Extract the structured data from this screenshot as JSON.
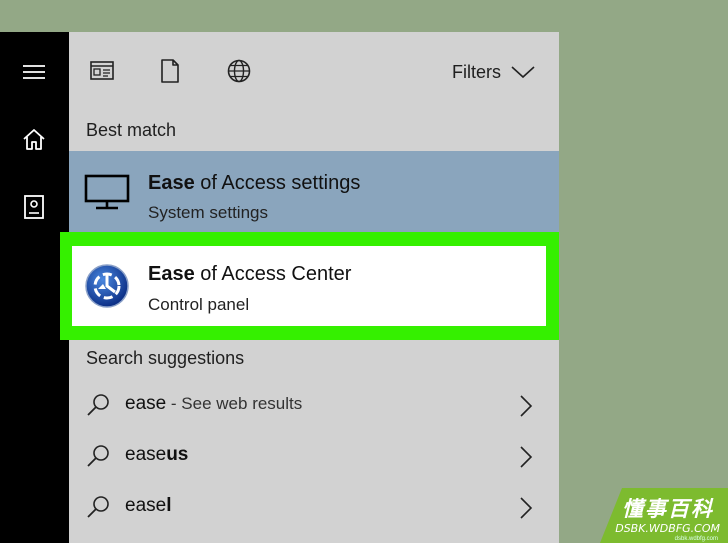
{
  "colors": {
    "desktop": "#93a886",
    "rail": "#000000",
    "panel": "#d2d2d2",
    "selected": "#8aa5bd",
    "highlight": "#35f000",
    "watermark": "#7dbb2f"
  },
  "rail": {
    "icons": [
      "hamburger-menu-icon",
      "home-icon",
      "notebook-icon"
    ]
  },
  "toolbar": {
    "icons": [
      "apps-icon",
      "documents-icon",
      "web-icon"
    ],
    "filters_label": "Filters"
  },
  "best_match": {
    "label": "Best match",
    "results": [
      {
        "title_bold": "Ease",
        "title_rest": " of Access settings",
        "subtitle": "System settings",
        "icon": "monitor-icon"
      },
      {
        "title_bold": "Ease",
        "title_rest": " of Access Center",
        "subtitle": "Control panel",
        "icon": "ease-of-access-icon"
      }
    ]
  },
  "suggestions": {
    "label": "Search suggestions",
    "items": [
      {
        "bold": "ease",
        "rest": "",
        "hint": " - See web results"
      },
      {
        "bold": "ease",
        "rest": "us",
        "hint": ""
      },
      {
        "bold": "ease",
        "rest": "l",
        "hint": ""
      }
    ]
  },
  "watermark": {
    "brand": "懂事百科",
    "url": "DSBK.WDBFG.COM",
    "small": "dsbk.wdbfg.com"
  }
}
